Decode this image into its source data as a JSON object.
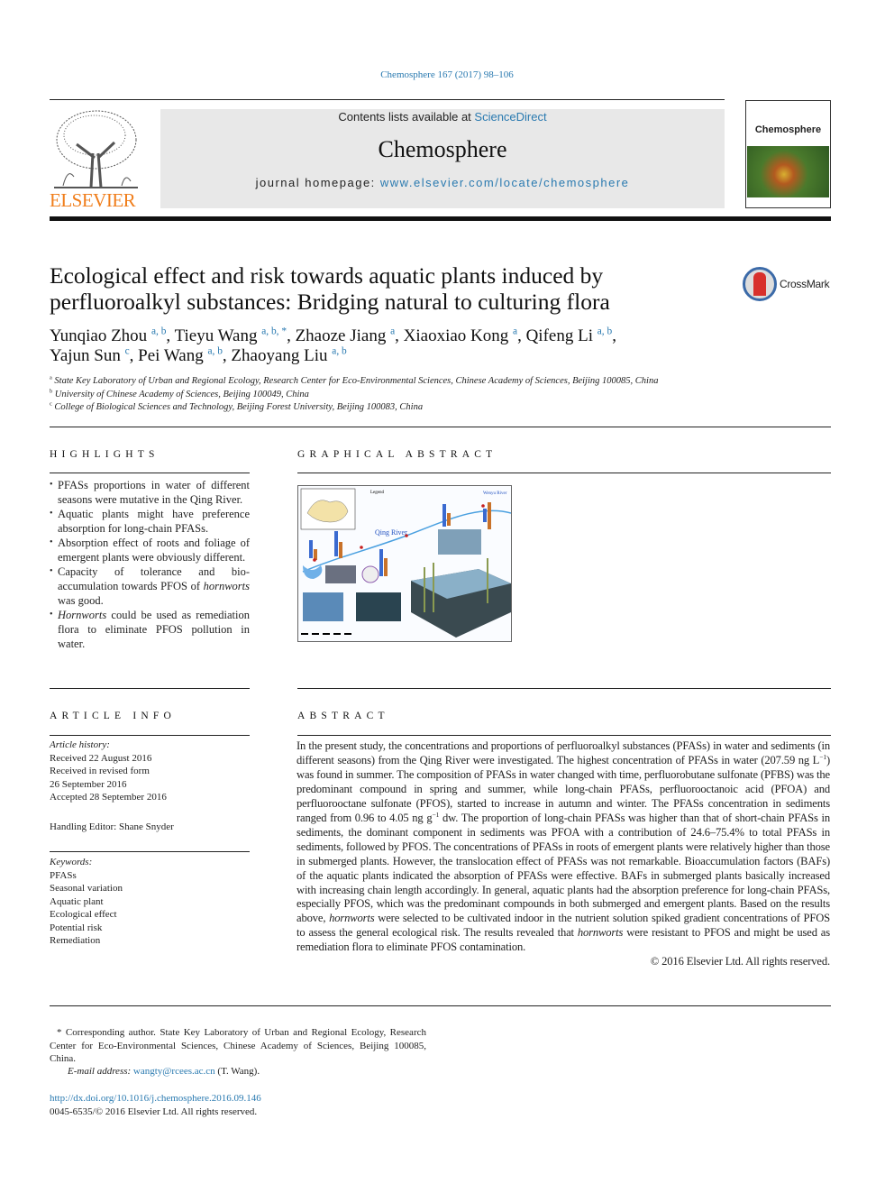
{
  "citation": "Chemosphere 167 (2017) 98–106",
  "publisher": {
    "logo_text": "ELSEVIER"
  },
  "banner": {
    "contents_prefix": "Contents lists available at ",
    "contents_link": "ScienceDirect",
    "journal_name": "Chemosphere",
    "homepage_prefix": "journal homepage: ",
    "homepage_link": "www.elsevier.com/locate/chemosphere"
  },
  "cover": {
    "title": "Chemosphere"
  },
  "crossmark": "CrossMark",
  "title": "Ecological effect and risk towards aquatic plants induced by perfluoroalkyl substances: Bridging natural to culturing flora",
  "authors": [
    {
      "name": "Yunqiao Zhou",
      "aff": "a, b"
    },
    {
      "name": "Tieyu Wang",
      "aff": "a, b, *"
    },
    {
      "name": "Zhaoze Jiang",
      "aff": "a"
    },
    {
      "name": "Xiaoxiao Kong",
      "aff": "a"
    },
    {
      "name": "Qifeng Li",
      "aff": "a, b"
    },
    {
      "name": "Yajun Sun",
      "aff": "c"
    },
    {
      "name": "Pei Wang",
      "aff": "a, b"
    },
    {
      "name": "Zhaoyang Liu",
      "aff": "a, b"
    }
  ],
  "affiliations": [
    {
      "key": "a",
      "text": "State Key Laboratory of Urban and Regional Ecology, Research Center for Eco-Environmental Sciences, Chinese Academy of Sciences, Beijing 100085, China"
    },
    {
      "key": "b",
      "text": "University of Chinese Academy of Sciences, Beijing 100049, China"
    },
    {
      "key": "c",
      "text": "College of Biological Sciences and Technology, Beijing Forest University, Beijing 100083, China"
    }
  ],
  "highlights": {
    "heading": "HIGHLIGHTS",
    "items": [
      "PFASs proportions in water of different seasons were mutative in the Qing River.",
      "Aquatic plants might have preference absorption for long-chain PFASs.",
      "Absorption effect of roots and foliage of emergent plants were obviously different.",
      {
        "a": "Capacity of tolerance and bio-accumulation towards PFOS of ",
        "i": "hornworts",
        "b": " was good."
      },
      {
        "i": "Hornworts",
        "b": " could be used as remediation flora to eliminate PFOS pollution in water."
      }
    ]
  },
  "graphical_abstract": {
    "heading": "GRAPHICAL ABSTRACT",
    "labels": {
      "river": "Qing River",
      "river2": "Wenyu River",
      "legend": "Legend"
    }
  },
  "article_info": {
    "heading": "ARTICLE INFO",
    "history_label": "Article history:",
    "history": [
      "Received 22 August 2016",
      "Received in revised form",
      "26 September 2016",
      "Accepted 28 September 2016"
    ],
    "editor": "Handling Editor: Shane Snyder",
    "keywords_label": "Keywords:",
    "keywords": [
      "PFASs",
      "Seasonal variation",
      "Aquatic plant",
      "Ecological effect",
      "Potential risk",
      "Remediation"
    ]
  },
  "abstract": {
    "heading": "ABSTRACT",
    "p1": "In the present study, the concentrations and proportions of perfluoroalkyl substances (PFASs) in water and sediments (in different seasons) from the Qing River were investigated. The highest concentration of PFASs in water (207.59 ng L",
    "sup1": "−1",
    "p2": ") was found in summer. The composition of PFASs in water changed with time, perfluorobutane sulfonate (PFBS) was the predominant compound in spring and summer, while long-chain PFASs, perfluorooctanoic acid (PFOA) and perfluorooctane sulfonate (PFOS), started to increase in autumn and winter. The PFASs concentration in sediments ranged from 0.96 to 4.05 ng g",
    "sup2": "−1",
    "p3": " dw. The proportion of long-chain PFASs was higher than that of short-chain PFASs in sediments, the dominant component in sediments was PFOA with a contribution of 24.6–75.4% to total PFASs in sediments, followed by PFOS. The concentrations of PFASs in roots of emergent plants were relatively higher than those in submerged plants. However, the translocation effect of PFASs was not remarkable. Bioaccumulation factors (BAFs) of the aquatic plants indicated the absorption of PFASs were effective. BAFs in submerged plants basically increased with increasing chain length accordingly. In general, aquatic plants had the absorption preference for long-chain PFASs, especially PFOS, which was the predominant compounds in both submerged and emergent plants. Based on the results above, ",
    "i1": "hornworts",
    "p4": " were selected to be cultivated indoor in the nutrient solution spiked gradient concentrations of PFOS to assess the general ecological risk. The results revealed that ",
    "i2": "hornworts",
    "p5": " were resistant to PFOS and might be used as remediation flora to eliminate PFOS contamination.",
    "copyright": "© 2016 Elsevier Ltd. All rights reserved."
  },
  "footnote": {
    "corresponding": "* Corresponding author. State Key Laboratory of Urban and Regional Ecology, Research Center for Eco-Environmental Sciences, Chinese Academy of Sciences, Beijing 100085, China.",
    "email_label": "E-mail address: ",
    "email": "wangty@rcees.ac.cn",
    "email_suffix": " (T. Wang).",
    "doi": "http://dx.doi.org/10.1016/j.chemosphere.2016.09.146",
    "issn": "0045-6535/© 2016 Elsevier Ltd. All rights reserved."
  },
  "colors": {
    "link": "#2a7ab0",
    "elsevier_orange": "#f07d1a"
  }
}
